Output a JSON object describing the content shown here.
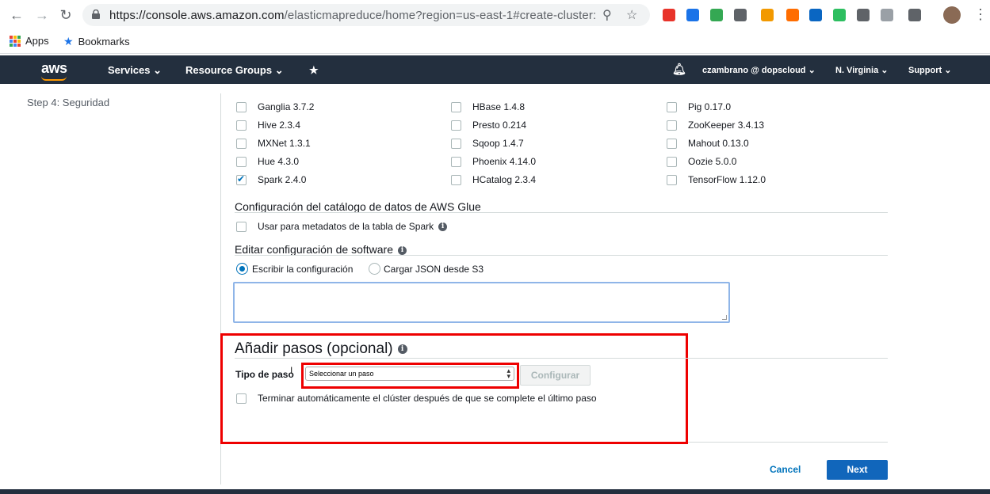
{
  "browser": {
    "url_host": "https://console.aws.amazon.com",
    "url_path": "/elasticmapreduce/home?region=us-east-1#create-cluster:",
    "bookmarks": [
      {
        "label": "Apps"
      },
      {
        "label": "Bookmarks"
      }
    ],
    "extension_colors": [
      "#e8332a",
      "#1a73e8",
      "#34a853",
      "#5f6368",
      "#f29900",
      "#ff6d00",
      "#0a66c2",
      "#2dbe60",
      "#5f6368",
      "#9aa0a6",
      "#5f6368"
    ]
  },
  "aws_nav": {
    "logo": "aws",
    "services": "Services",
    "resource_groups": "Resource Groups",
    "user": "czambrano @ dopscloud",
    "region": "N. Virginia",
    "support": "Support"
  },
  "sidebar": {
    "step": "Step 4: Seguridad"
  },
  "applications": [
    {
      "label": "Ganglia 3.7.2",
      "checked": false
    },
    {
      "label": "HBase 1.4.8",
      "checked": false
    },
    {
      "label": "Pig 0.17.0",
      "checked": false
    },
    {
      "label": "Hive 2.3.4",
      "checked": false
    },
    {
      "label": "Presto 0.214",
      "checked": false
    },
    {
      "label": "ZooKeeper 3.4.13",
      "checked": false
    },
    {
      "label": "MXNet 1.3.1",
      "checked": false
    },
    {
      "label": "Sqoop 1.4.7",
      "checked": false
    },
    {
      "label": "Mahout 0.13.0",
      "checked": false
    },
    {
      "label": "Hue 4.3.0",
      "checked": false
    },
    {
      "label": "Phoenix 4.14.0",
      "checked": false
    },
    {
      "label": "Oozie 5.0.0",
      "checked": false
    },
    {
      "label": "Spark 2.4.0",
      "checked": true
    },
    {
      "label": "HCatalog 2.3.4",
      "checked": false
    },
    {
      "label": "TensorFlow 1.12.0",
      "checked": false
    }
  ],
  "glue": {
    "title": "Configuración del catálogo de datos de AWS Glue",
    "checkbox_label": "Usar para metadatos de la tabla de Spark"
  },
  "software_config": {
    "title": "Editar configuración de software",
    "option_write": "Escribir la configuración",
    "option_json": "Cargar JSON desde S3",
    "value": ""
  },
  "steps": {
    "title": "Añadir pasos (opcional)",
    "step_type_label": "Tipo de paso",
    "select_value": "Seleccionar un paso",
    "configure_button": "Configurar",
    "auto_terminate_label": "Terminar automáticamente el clúster después de que se complete el último paso"
  },
  "footer": {
    "cancel": "Cancel",
    "next": "Next"
  }
}
